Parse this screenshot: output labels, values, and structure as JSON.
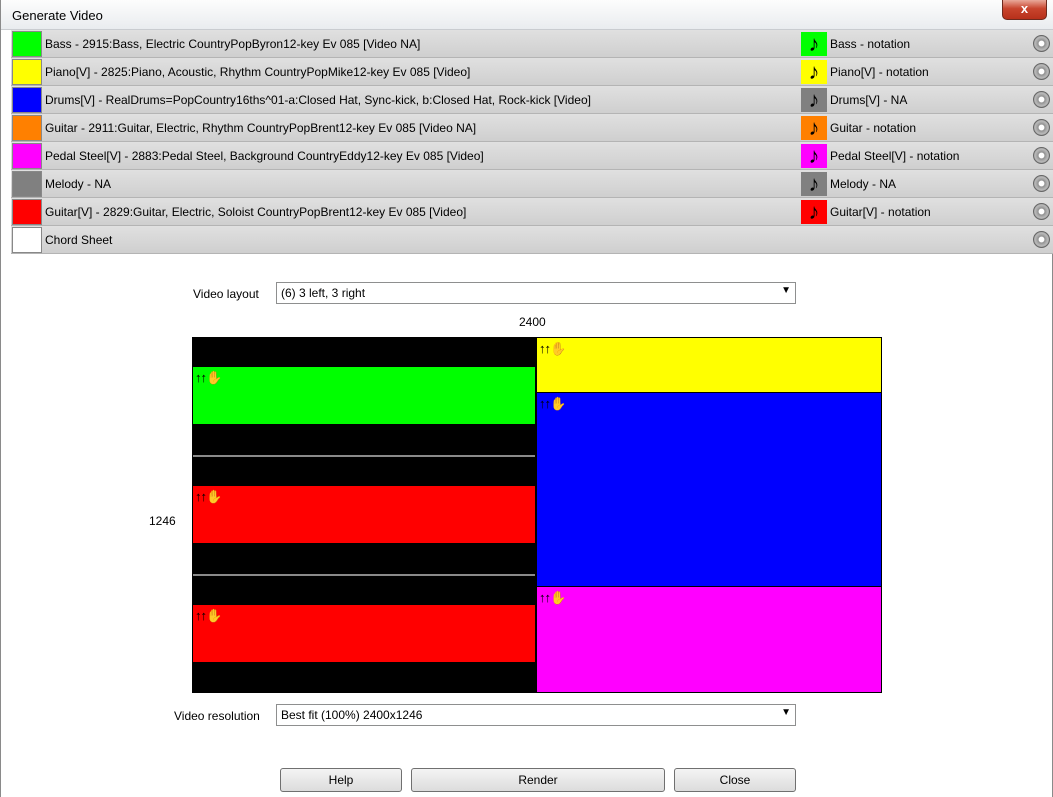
{
  "window": {
    "title": "Generate Video",
    "close_glyph": "x"
  },
  "tracks": [
    {
      "color": "#00ff00",
      "label": "Bass - 2915:Bass, Electric CountryPopByron12-key Ev 085 [Video NA]",
      "notation": "Bass - notation",
      "note_color": "#00ff00"
    },
    {
      "color": "#ffff00",
      "label": "Piano[V] - 2825:Piano, Acoustic, Rhythm CountryPopMike12-key Ev 085 [Video]",
      "notation": "Piano[V] - notation",
      "note_color": "#ffff00"
    },
    {
      "color": "#0000ff",
      "label": "Drums[V] - RealDrums=PopCountry16ths^01-a:Closed Hat, Sync-kick, b:Closed Hat, Rock-kick [Video]",
      "notation": "Drums[V] - NA",
      "note_color": "#808080"
    },
    {
      "color": "#ff8000",
      "label": "Guitar - 2911:Guitar, Electric, Rhythm CountryPopBrent12-key Ev 085 [Video NA]",
      "notation": "Guitar - notation",
      "note_color": "#ff8000"
    },
    {
      "color": "#ff00ff",
      "label": "Pedal Steel[V] - 2883:Pedal Steel, Background CountryEddy12-key Ev 085 [Video]",
      "notation": "Pedal Steel[V] - notation",
      "note_color": "#ff00ff"
    },
    {
      "color": "#808080",
      "label": "Melody - NA",
      "notation": "Melody - NA",
      "note_color": "#808080"
    },
    {
      "color": "#ff0000",
      "label": "Guitar[V] - 2829:Guitar, Electric, Soloist CountryPopBrent12-key Ev 085 [Video]",
      "notation": "Guitar[V] - notation",
      "note_color": "#ff0000"
    },
    {
      "color": "#ffffff",
      "label": "Chord Sheet",
      "notation": "",
      "note_color": ""
    }
  ],
  "video_layout": {
    "label": "Video layout",
    "value": "(6) 3 left, 3 right"
  },
  "preview": {
    "width_label": "2400",
    "height_label": "1246",
    "handle_glyphs": "↑↑✋",
    "panels": [
      {
        "color": "#00ff00",
        "side": "left"
      },
      {
        "color": "#ff0000",
        "side": "left"
      },
      {
        "color": "#ff0000",
        "side": "left"
      },
      {
        "color": "#ffff00",
        "side": "right"
      },
      {
        "color": "#0000ff",
        "side": "right"
      },
      {
        "color": "#ff00ff",
        "side": "right"
      }
    ]
  },
  "video_resolution": {
    "label": "Video resolution",
    "value": "Best fit (100%) 2400x1246"
  },
  "buttons": {
    "help": "Help",
    "render": "Render",
    "close": "Close"
  }
}
